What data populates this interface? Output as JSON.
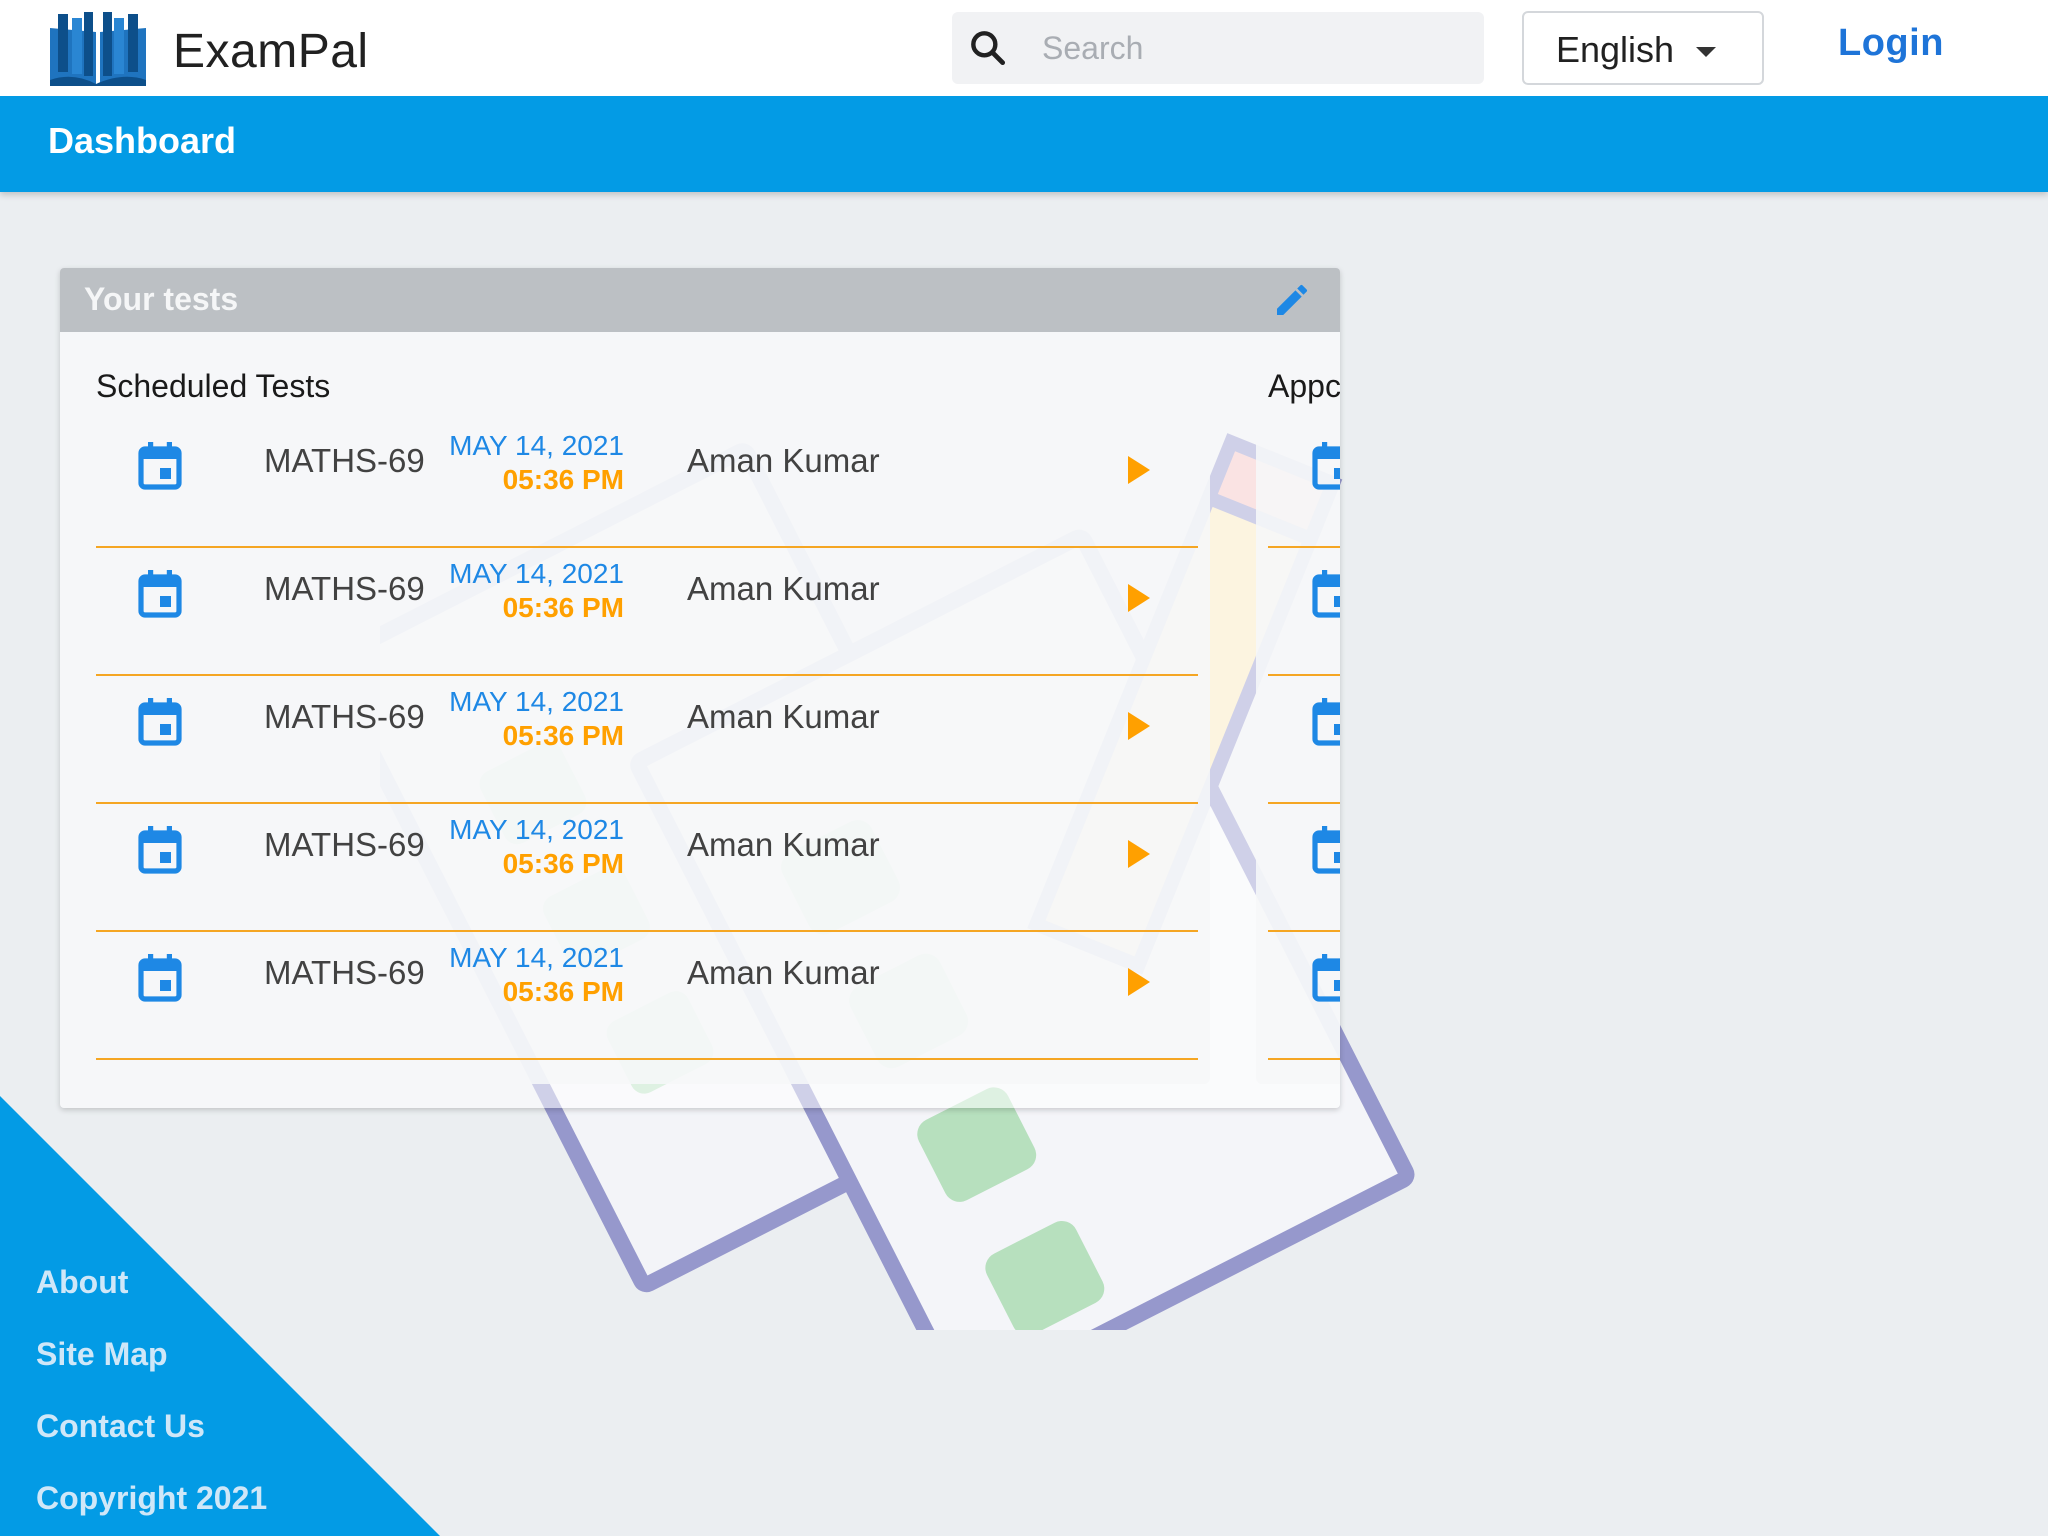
{
  "app": {
    "brand": "ExamPal"
  },
  "search": {
    "placeholder": "Search"
  },
  "language": {
    "selected": "English"
  },
  "auth": {
    "login_label": "Login"
  },
  "subheader": {
    "title": "Dashboard"
  },
  "tests_card": {
    "title": "Your tests",
    "scheduled": {
      "title": "Scheduled Tests",
      "rows": [
        {
          "code": "MATHS-69",
          "date": "MAY 14, 2021",
          "time": "05:36 PM",
          "name": "Aman Kumar"
        },
        {
          "code": "MATHS-69",
          "date": "MAY 14, 2021",
          "time": "05:36 PM",
          "name": "Aman Kumar"
        },
        {
          "code": "MATHS-69",
          "date": "MAY 14, 2021",
          "time": "05:36 PM",
          "name": "Aman Kumar"
        },
        {
          "code": "MATHS-69",
          "date": "MAY 14, 2021",
          "time": "05:36 PM",
          "name": "Aman Kumar"
        },
        {
          "code": "MATHS-69",
          "date": "MAY 14, 2021",
          "time": "05:36 PM",
          "name": "Aman Kumar"
        }
      ]
    },
    "approved": {
      "title": "Appc"
    }
  },
  "footer": {
    "links": [
      "About",
      "Site Map",
      "Contact Us",
      "Copyright 2021"
    ]
  },
  "colors": {
    "primary": "#039be5",
    "accent": "#ffa000",
    "date_blue": "#1e88e5",
    "link_blue": "#1e74d8",
    "card_header": "#bcc0c4",
    "page_bg": "#ebeef1"
  },
  "icons": {
    "logo": "open-book-icon",
    "search": "magnifier-icon",
    "edit": "pencil-icon",
    "row": "calendar-icon",
    "play": "play-triangle-icon",
    "dropdown": "caret-down-icon"
  }
}
